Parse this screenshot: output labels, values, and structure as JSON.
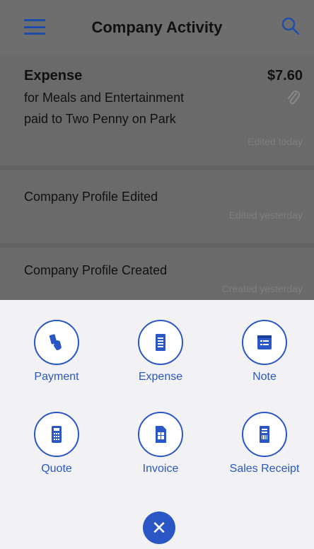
{
  "header": {
    "title": "Company Activity"
  },
  "activities": [
    {
      "type": "Expense",
      "amount": "$7.60",
      "line1": "for Meals and Entertainment",
      "line2": "paid to Two Penny on Park",
      "status": "Edited today"
    },
    {
      "title": "Company Profile Edited",
      "status": "Edited yesterday"
    },
    {
      "title": "Company Profile Created",
      "status": "Created yesterday"
    }
  ],
  "actions": [
    {
      "label": "Payment",
      "icon": "payment-icon"
    },
    {
      "label": "Expense",
      "icon": "expense-icon"
    },
    {
      "label": "Note",
      "icon": "note-icon"
    },
    {
      "label": "Quote",
      "icon": "quote-icon"
    },
    {
      "label": "Invoice",
      "icon": "invoice-icon"
    },
    {
      "label": "Sales Receipt",
      "icon": "sales-receipt-icon"
    }
  ],
  "colors": {
    "accent": "#2a56c6",
    "overlay": "#6a6a6a",
    "sheet": "#f2f2f4"
  }
}
